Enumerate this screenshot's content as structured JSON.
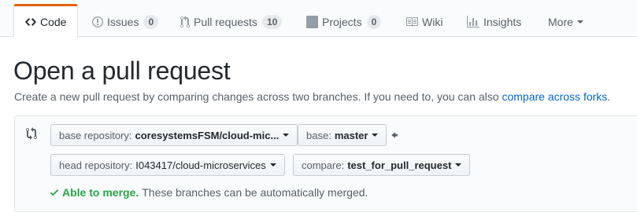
{
  "tabs": [
    {
      "label": "Code",
      "icon": "code-icon"
    },
    {
      "label": "Issues",
      "icon": "issue-icon",
      "count": "0"
    },
    {
      "label": "Pull requests",
      "icon": "pull-request-icon",
      "count": "10"
    },
    {
      "label": "Projects",
      "icon": "project-icon",
      "count": "0"
    },
    {
      "label": "Wiki",
      "icon": "book-icon"
    },
    {
      "label": "Insights",
      "icon": "graph-icon"
    },
    {
      "label": "More",
      "icon": "chevron-down-icon"
    }
  ],
  "page": {
    "title": "Open a pull request",
    "subtitle": "Create a new pull request by comparing changes across two branches. If you need to, you can also",
    "compare_forks_link": "compare across forks",
    "subtitle_end": "."
  },
  "compare": {
    "base_repo_label": "base repository:",
    "base_repo_value": "coresystemsFSM/cloud-mic...",
    "base_label": "base:",
    "base_value": "master",
    "head_repo_label": "head repository:",
    "head_repo_value": "I043417/cloud-microservices",
    "compare_label": "compare:",
    "compare_value": "test_for_pull_request"
  },
  "merge_status": {
    "status": "Able to merge.",
    "message": "These branches can be automatically merged."
  },
  "colors": {
    "accent_tab": "#e36209",
    "link": "#0366d6",
    "success": "#28a745"
  }
}
